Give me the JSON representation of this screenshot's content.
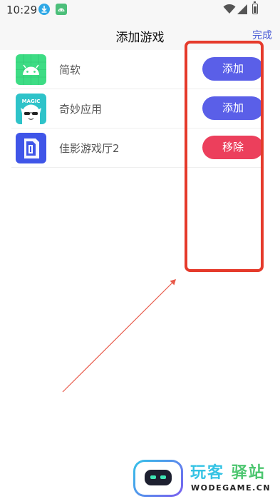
{
  "status_bar": {
    "time": "10:29"
  },
  "header": {
    "title": "添加游戏",
    "done_label": "完成"
  },
  "games": [
    {
      "name": "简软",
      "action": "添加",
      "icon": "android-icon"
    },
    {
      "name": "奇妙应用",
      "action": "添加",
      "icon": "magic-app-icon"
    },
    {
      "name": "佳影游戏厅2",
      "action": "移除",
      "icon": "jiaying-icon"
    }
  ],
  "watermark": {
    "cn_part1": "玩客",
    "cn_part2": "驿站",
    "en": "WODEGAME.CN"
  }
}
